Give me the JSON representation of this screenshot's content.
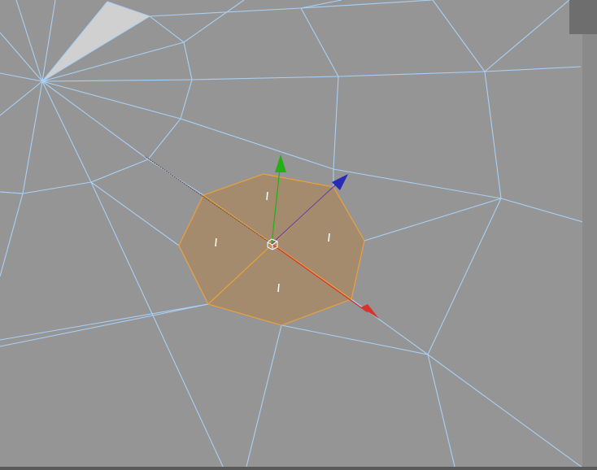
{
  "viewport": {
    "background_color": "#959595",
    "wire_color": "#a8d0f5",
    "selection": {
      "fill_color": "#a58a6a",
      "edge_color": "#e8a13a",
      "selected_polygon_count": 4
    },
    "gizmo": {
      "x_axis_color": "#d8322a",
      "y_axis_color": "#22b014",
      "z_axis_color": "#2a2ab8",
      "pivot_icon": "pivot-cube-icon"
    },
    "pole_highlight_color": "#d0d0d0"
  }
}
